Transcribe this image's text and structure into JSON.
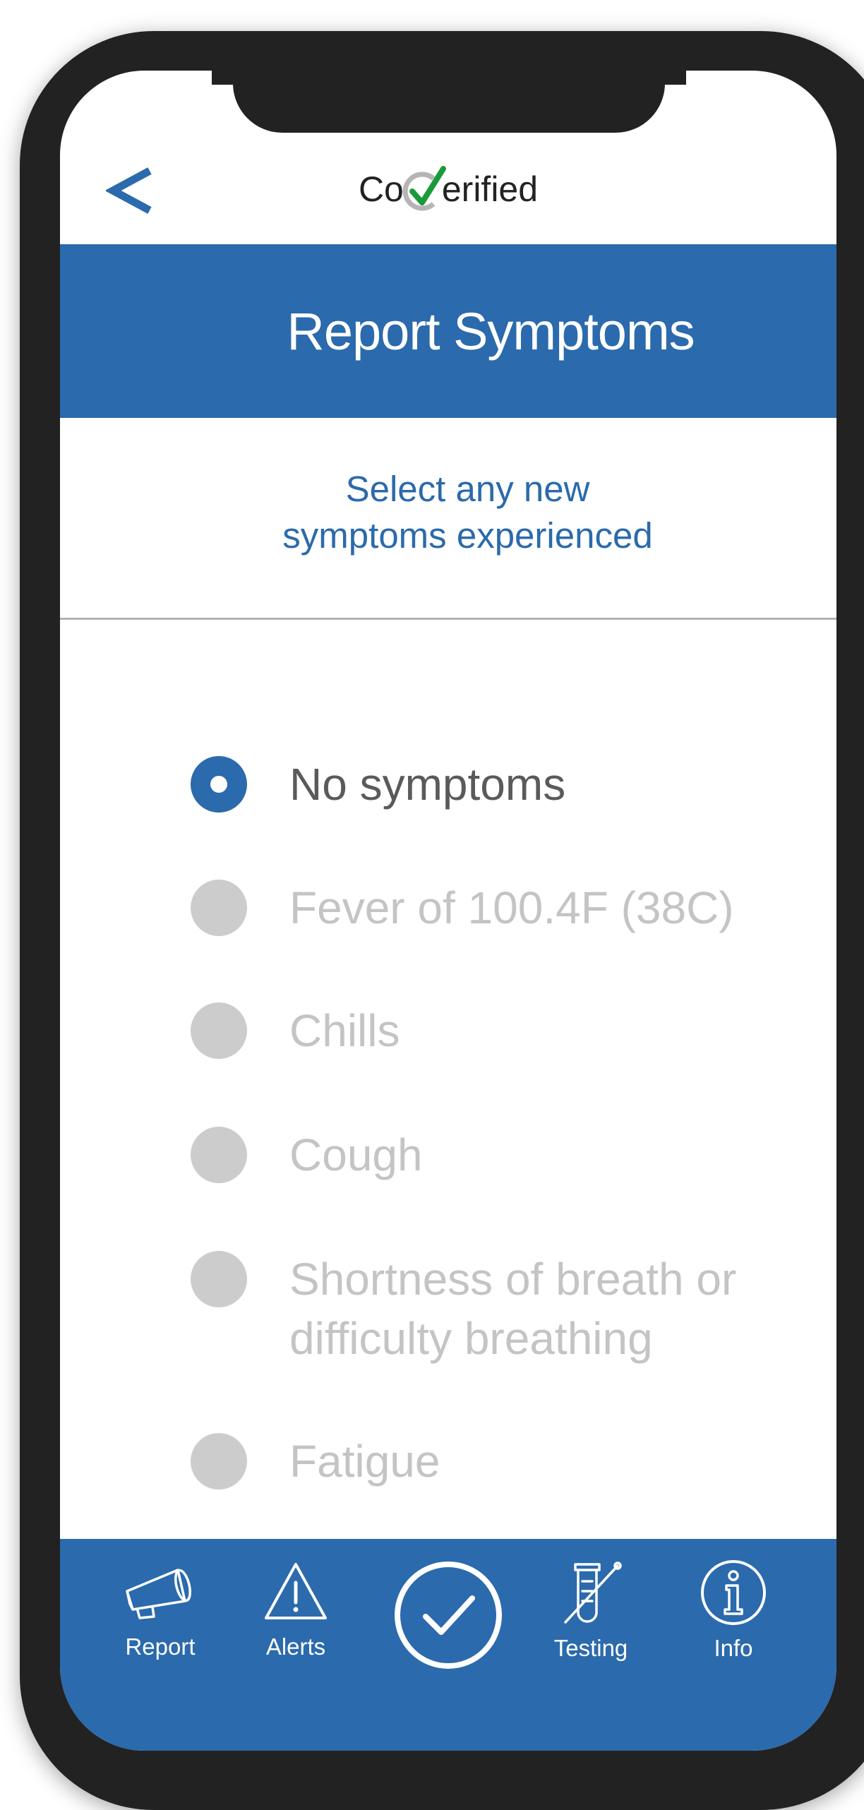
{
  "app": {
    "logo_text_left": "Co",
    "logo_text_right": "erified",
    "back_icon": "chevron-left-icon"
  },
  "header": {
    "title": "Report Symptoms"
  },
  "instruction": {
    "line1": "Select any new",
    "line2": "symptoms experienced"
  },
  "symptoms": [
    {
      "label": "No symptoms",
      "selected": true
    },
    {
      "label": "Fever of 100.4F (38C)",
      "selected": false
    },
    {
      "label": "Chills",
      "selected": false
    },
    {
      "label": "Cough",
      "selected": false
    },
    {
      "label": "Shortness of breath or difficulty breathing",
      "selected": false
    },
    {
      "label": "Fatigue",
      "selected": false
    }
  ],
  "nav": {
    "report": "Report",
    "alerts": "Alerts",
    "testing": "Testing",
    "info": "Info",
    "confirm_icon": "checkmark-icon"
  },
  "colors": {
    "brand_blue": "#2b6aac",
    "selected_text": "#5a5a5a",
    "unselected_text": "#c4c4c4",
    "radio_unselected": "#cccccc",
    "logo_green": "#1a9a3a"
  }
}
